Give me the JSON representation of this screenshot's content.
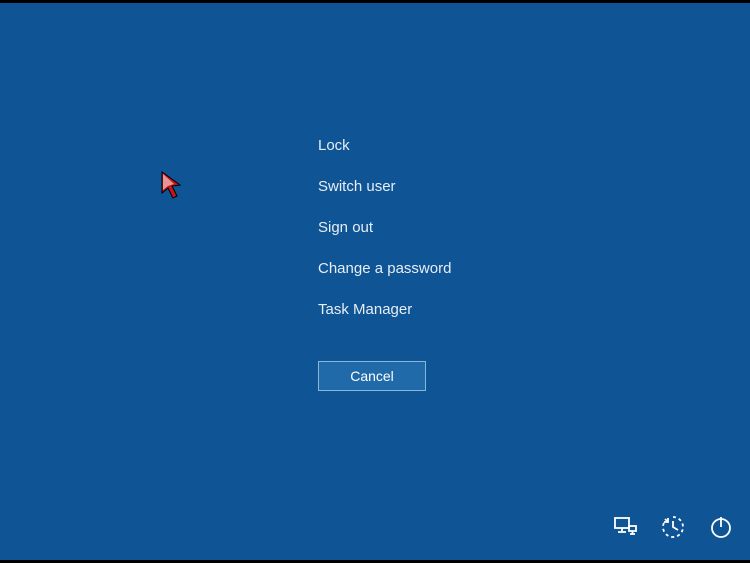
{
  "menu": {
    "items": [
      {
        "id": "lock",
        "label": "Lock"
      },
      {
        "id": "switch-user",
        "label": "Switch user"
      },
      {
        "id": "sign-out",
        "label": "Sign out"
      },
      {
        "id": "change-password",
        "label": "Change a password"
      },
      {
        "id": "task-manager",
        "label": "Task Manager"
      }
    ]
  },
  "cancel_label": "Cancel",
  "tray": {
    "network_icon": "network-icon",
    "ease_of_access_icon": "ease-of-access-icon",
    "power_icon": "power-icon"
  },
  "colors": {
    "background": "#0f5494",
    "button_bg": "#206aa9",
    "button_border": "#8ab6d9",
    "text": "#ffffff"
  }
}
